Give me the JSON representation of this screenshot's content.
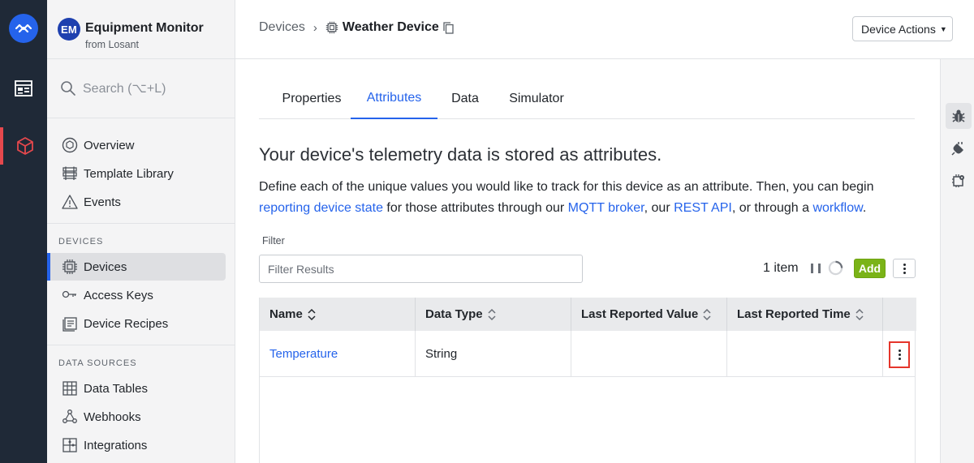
{
  "app": {
    "initials": "EM",
    "name": "Equipment Monitor",
    "org": "from Losant"
  },
  "search": {
    "placeholder": "Search (⌥+L)"
  },
  "nav": {
    "overview": "Overview",
    "template_library": "Template Library",
    "events": "Events",
    "devices_section": "DEVICES",
    "devices": "Devices",
    "access_keys": "Access Keys",
    "device_recipes": "Device Recipes",
    "data_sources_section": "DATA SOURCES",
    "data_tables": "Data Tables",
    "webhooks": "Webhooks",
    "integrations": "Integrations"
  },
  "breadcrumb": {
    "parent": "Devices",
    "separator": "›",
    "current": "Weather Device"
  },
  "header": {
    "device_actions": "Device Actions"
  },
  "tabs": [
    {
      "label": "Properties"
    },
    {
      "label": "Attributes",
      "active": true
    },
    {
      "label": "Data"
    },
    {
      "label": "Simulator"
    }
  ],
  "content": {
    "headline": "Your device's telemetry data is stored as attributes.",
    "desc_part1": "Define each of the unique values you would like to track for this device as an attribute. Then, you can begin ",
    "link_reporting": "reporting device state",
    "desc_part2": " for those attributes through our ",
    "link_mqtt": "MQTT broker",
    "desc_part3": ", our ",
    "link_rest": "REST API",
    "desc_part4": ", or through a ",
    "link_workflow": "workflow",
    "desc_part5": "."
  },
  "filter": {
    "label": "Filter",
    "placeholder": "Filter Results",
    "value": ""
  },
  "list": {
    "count": "1 item",
    "add_label": "Add"
  },
  "table": {
    "columns": [
      "Name",
      "Data Type",
      "Last Reported Value",
      "Last Reported Time"
    ],
    "rows": [
      {
        "name": "Temperature",
        "data_type": "String",
        "last_value": "",
        "last_time": ""
      }
    ]
  },
  "colors": {
    "accent": "#2563eb",
    "add_green": "#7ab317",
    "rail": "#1f2937",
    "highlight": "#e5352b"
  }
}
